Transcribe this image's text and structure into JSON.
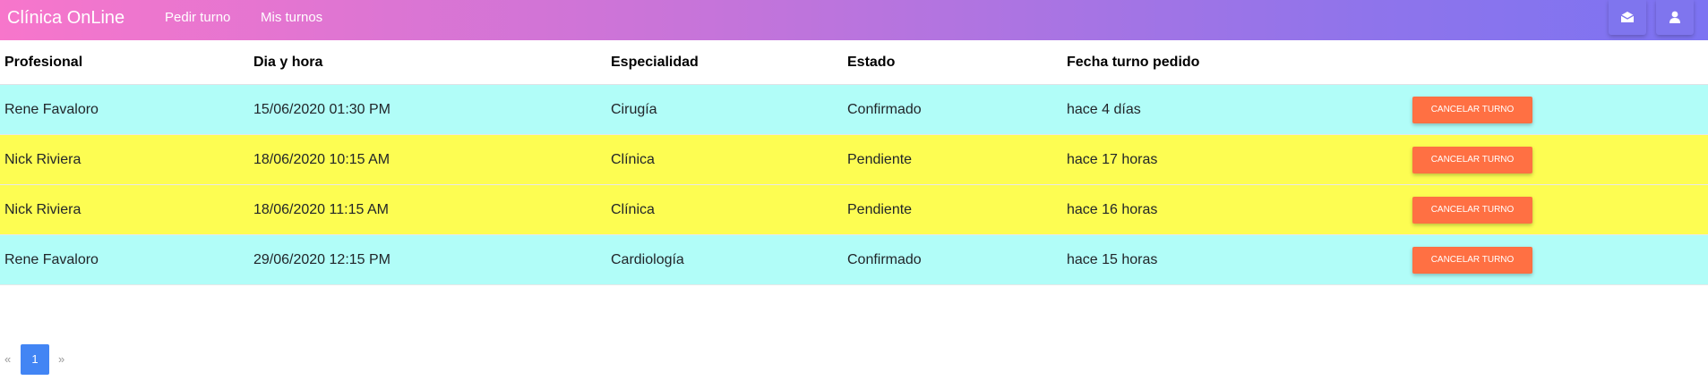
{
  "navbar": {
    "brand": "Clínica OnLine",
    "links": [
      "Pedir turno",
      "Mis turnos"
    ],
    "icons": [
      "mail-icon",
      "user-icon"
    ]
  },
  "table": {
    "headers": [
      "Profesional",
      "Dia y hora",
      "Especialidad",
      "Estado",
      "Fecha turno pedido"
    ],
    "rows": [
      {
        "profesional": "Rene Favaloro",
        "dia_hora": "15/06/2020 01:30 PM",
        "especialidad": "Cirugía",
        "estado": "Confirmado",
        "fecha_pedido": "hace 4 días",
        "action": "CANCELAR TURNO",
        "color": "#b1fdf8"
      },
      {
        "profesional": "Nick Riviera",
        "dia_hora": "18/06/2020 10:15 AM",
        "especialidad": "Clínica",
        "estado": "Pendiente",
        "fecha_pedido": "hace 17 horas",
        "action": "CANCELAR TURNO",
        "color": "#fdfd52"
      },
      {
        "profesional": "Nick Riviera",
        "dia_hora": "18/06/2020 11:15 AM",
        "especialidad": "Clínica",
        "estado": "Pendiente",
        "fecha_pedido": "hace 16 horas",
        "action": "CANCELAR TURNO",
        "color": "#fdfd52"
      },
      {
        "profesional": "Rene Favaloro",
        "dia_hora": "29/06/2020 12:15 PM",
        "especialidad": "Cardiología",
        "estado": "Confirmado",
        "fecha_pedido": "hace 15 horas",
        "action": "CANCELAR TURNO",
        "color": "#b1fdf8"
      }
    ]
  },
  "pagination": {
    "prev": "«",
    "current": "1",
    "next": "»"
  },
  "colors": {
    "accent": "#ff7043",
    "page_active": "#4285f4",
    "confirmado": "#b1fdf8",
    "pendiente": "#fdfd52"
  }
}
